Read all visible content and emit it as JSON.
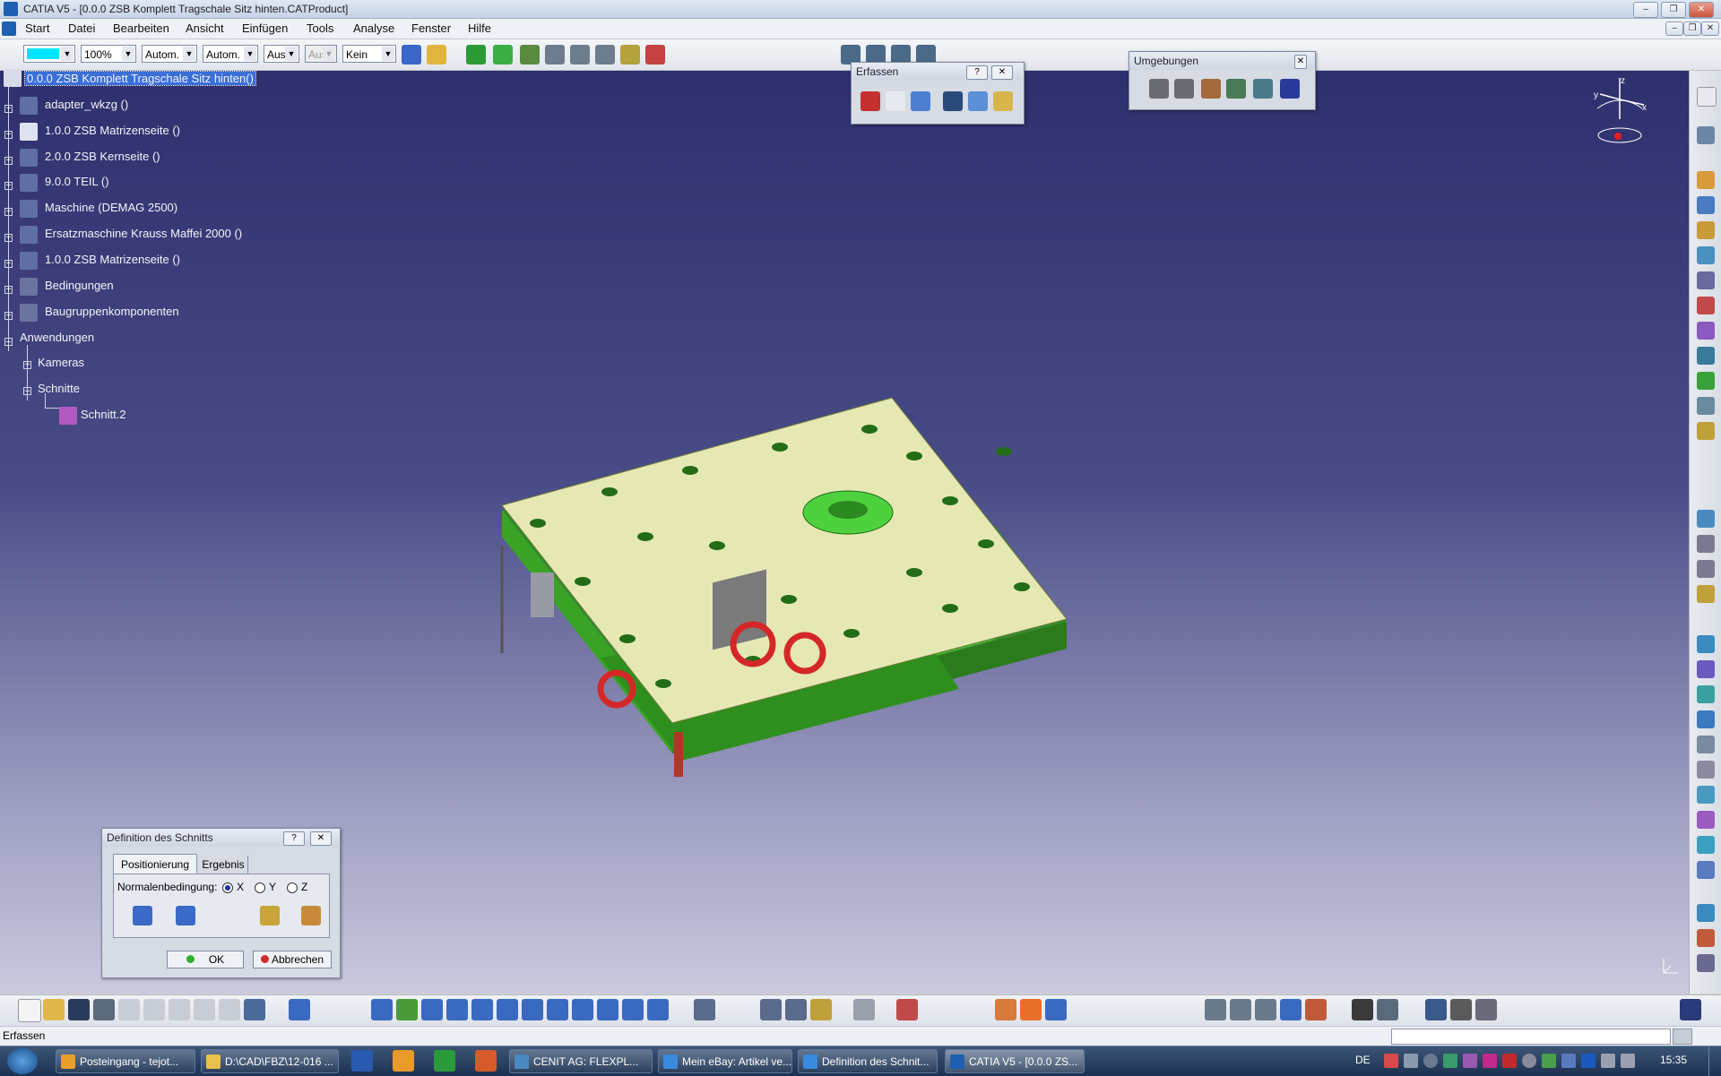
{
  "window": {
    "title": "CATIA V5 - [0.0.0 ZSB Komplett Tragschale Sitz hinten.CATProduct]"
  },
  "menu": {
    "items": [
      "Start",
      "Datei",
      "Bearbeiten",
      "Ansicht",
      "Einfügen",
      "Tools",
      "Analyse",
      "Fenster",
      "Hilfe"
    ]
  },
  "toolbar": {
    "zoom": "100%",
    "combo_auto1": "Autom.",
    "combo_auto2": "Autom.",
    "combo_aus": "Aus",
    "combo_aus2": "Aus",
    "combo_kein": "Kein",
    "color_swatch": "#00e5ff"
  },
  "tree": {
    "root": "0.0.0 ZSB Komplett Tragschale Sitz hinten()",
    "items": [
      "adapter_wkzg ()",
      "1.0.0 ZSB Matrizenseite ()",
      "2.0.0 ZSB Kernseite ()",
      "9.0.0 TEIL ()",
      "Maschine (DEMAG 2500)",
      "Ersatzmaschine  Krauss Maffei 2000 ()",
      "1.0.0 ZSB Matrizenseite ()",
      "Bedingungen",
      "Baugruppenkomponenten"
    ],
    "anwendungen": "Anwendungen",
    "kameras": "Kameras",
    "schnitte": "Schnitte",
    "schnitt": "Schnitt.2"
  },
  "erfassen_panel": {
    "title": "Erfassen"
  },
  "umgebungen_panel": {
    "title": "Umgebungen"
  },
  "compass": {
    "x": "x",
    "y": "y",
    "z": "z"
  },
  "section_dialog": {
    "title": "Definition des Schnitts",
    "tabs": [
      "Positionierung",
      "Ergebnis"
    ],
    "normal_label": "Normalenbedingung:",
    "options": [
      "X",
      "Y",
      "Z"
    ],
    "selected": "X",
    "ok": "OK",
    "cancel": "Abbrechen"
  },
  "status": {
    "text": "Erfassen"
  },
  "taskbar": {
    "items": [
      "Posteingang - tejot...",
      "D:\\CAD\\FBZ\\12-016 ...",
      "CENIT AG: FLEXPL...",
      "Mein eBay: Artikel ve...",
      "Definition des Schnit...",
      "CATIA V5 - [0.0.0 ZS..."
    ],
    "lang": "DE",
    "clock": "15:35"
  },
  "colors": {
    "viewport_top": "#2e2f6d",
    "viewport_bottom": "#c9c9de",
    "tree_highlight": "#3a6fd8",
    "mold_top": "#e6e8b4",
    "mold_body": "#2f8f1e"
  }
}
